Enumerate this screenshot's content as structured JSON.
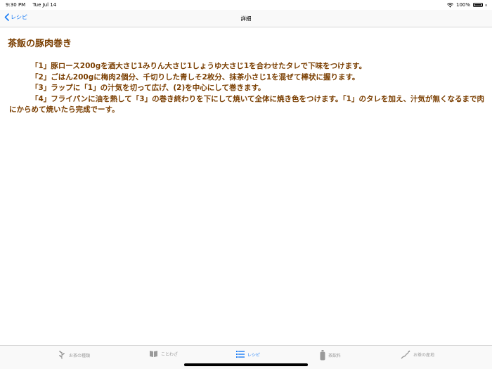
{
  "status": {
    "time": "9:30 PM",
    "date": "Tue Jul 14",
    "battery": "100%",
    "battery_level": 1.0
  },
  "nav": {
    "back_label": "レシピ",
    "title": "詳細"
  },
  "recipe": {
    "title": "茶飯の豚肉巻き",
    "steps": [
      "「1」豚ロース200gを酒大さじ1みりん大さじ1しょうゆ大さじ1を合わせたタレで下味をつけます。",
      "「2」ごはん200gに梅肉2個分、千切りした青しそ2枚分、抹茶小さじ1を混ぜて棒状に握ります。",
      "「3」ラップに「1」の汁気を切って広げ、(2)を中心にして巻きます。",
      "「4」フライパンに油を熱して「3」の巻き終わりを下にして焼いて全体に焼き色をつけます。「1」のタレを加え、汁気が無くなるまで肉にからめて焼いたら完成でーす。"
    ]
  },
  "tabs": [
    {
      "label": "お茶の種類",
      "icon": "tea-plant-icon",
      "active": false
    },
    {
      "label": "ことわざ",
      "icon": "book-icon",
      "active": false
    },
    {
      "label": "レシピ",
      "icon": "list-icon",
      "active": true
    },
    {
      "label": "茶飲料",
      "icon": "bottle-icon",
      "active": false
    },
    {
      "label": "お茶の産地",
      "icon": "map-icon",
      "active": false
    }
  ],
  "colors": {
    "accent": "#1a7cf5",
    "text_brown": "#7a3e00",
    "inactive": "#9a9a9a"
  }
}
